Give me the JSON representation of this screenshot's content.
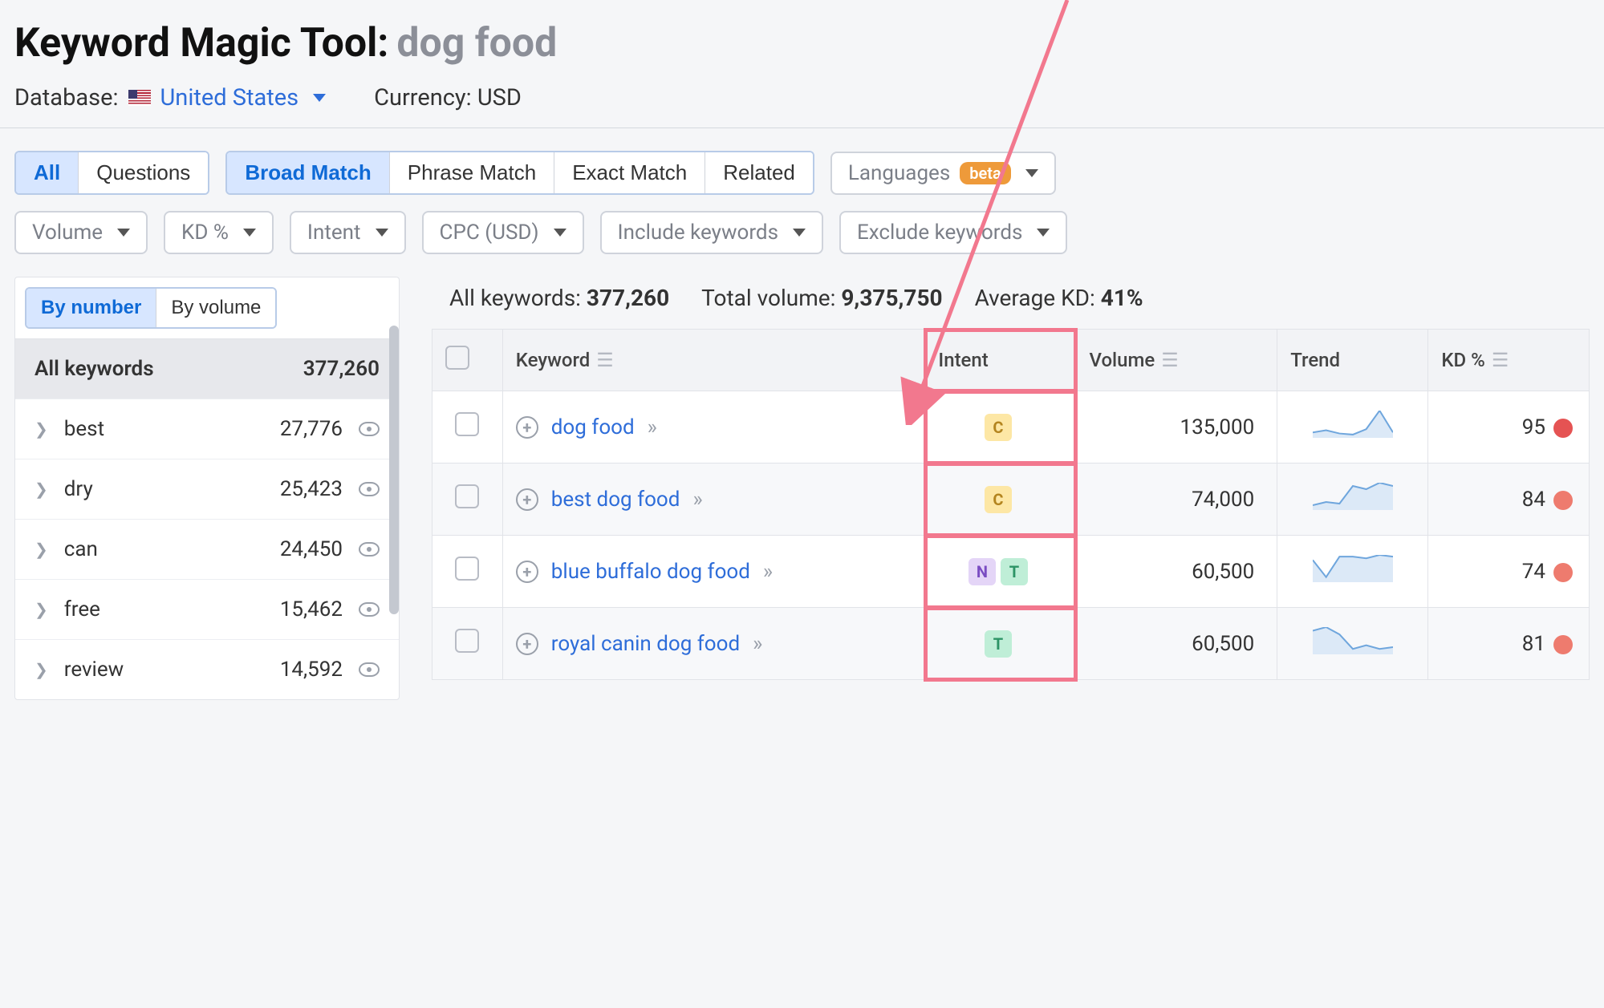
{
  "header": {
    "tool_title": "Keyword Magic Tool:",
    "keyword": "dog food",
    "database_label": "Database:",
    "database_value": "United States",
    "currency_label": "Currency: USD"
  },
  "filter_tabs_1": {
    "all": "All",
    "questions": "Questions"
  },
  "filter_tabs_2": {
    "broad": "Broad Match",
    "phrase": "Phrase Match",
    "exact": "Exact Match",
    "related": "Related"
  },
  "languages": {
    "label": "Languages",
    "badge": "beta"
  },
  "filter_pills": {
    "volume": "Volume",
    "kd": "KD %",
    "intent": "Intent",
    "cpc": "CPC (USD)",
    "include": "Include keywords",
    "exclude": "Exclude keywords"
  },
  "sidebar": {
    "by_number": "By number",
    "by_volume": "By volume",
    "all_label": "All keywords",
    "all_count": "377,260",
    "groups": [
      {
        "name": "best",
        "count": "27,776"
      },
      {
        "name": "dry",
        "count": "25,423"
      },
      {
        "name": "can",
        "count": "24,450"
      },
      {
        "name": "free",
        "count": "15,462"
      },
      {
        "name": "review",
        "count": "14,592"
      }
    ]
  },
  "stats": {
    "all_keywords_label": "All keywords:",
    "all_keywords_value": "377,260",
    "total_volume_label": "Total volume:",
    "total_volume_value": "9,375,750",
    "avg_kd_label": "Average KD:",
    "avg_kd_value": "41%"
  },
  "columns": {
    "keyword": "Keyword",
    "intent": "Intent",
    "volume": "Volume",
    "trend": "Trend",
    "kd": "KD %"
  },
  "rows": [
    {
      "keyword": "dog food",
      "intents": [
        "C"
      ],
      "volume": "135,000",
      "kd": "95",
      "kd_class": "kd-red",
      "trend": [
        20,
        22,
        19,
        18,
        23,
        40,
        20
      ]
    },
    {
      "keyword": "best dog food",
      "intents": [
        "C"
      ],
      "volume": "74,000",
      "kd": "84",
      "kd_class": "kd-redl",
      "trend": [
        18,
        20,
        19,
        30,
        28,
        32,
        30
      ]
    },
    {
      "keyword": "blue buffalo dog food",
      "intents": [
        "N",
        "T"
      ],
      "volume": "60,500",
      "kd": "74",
      "kd_class": "kd-redl",
      "trend": [
        28,
        18,
        30,
        30,
        29,
        31,
        30
      ]
    },
    {
      "keyword": "royal canin dog food",
      "intents": [
        "T"
      ],
      "volume": "60,500",
      "kd": "81",
      "kd_class": "kd-redl",
      "trend": [
        28,
        30,
        26,
        18,
        20,
        18,
        19
      ]
    }
  ]
}
